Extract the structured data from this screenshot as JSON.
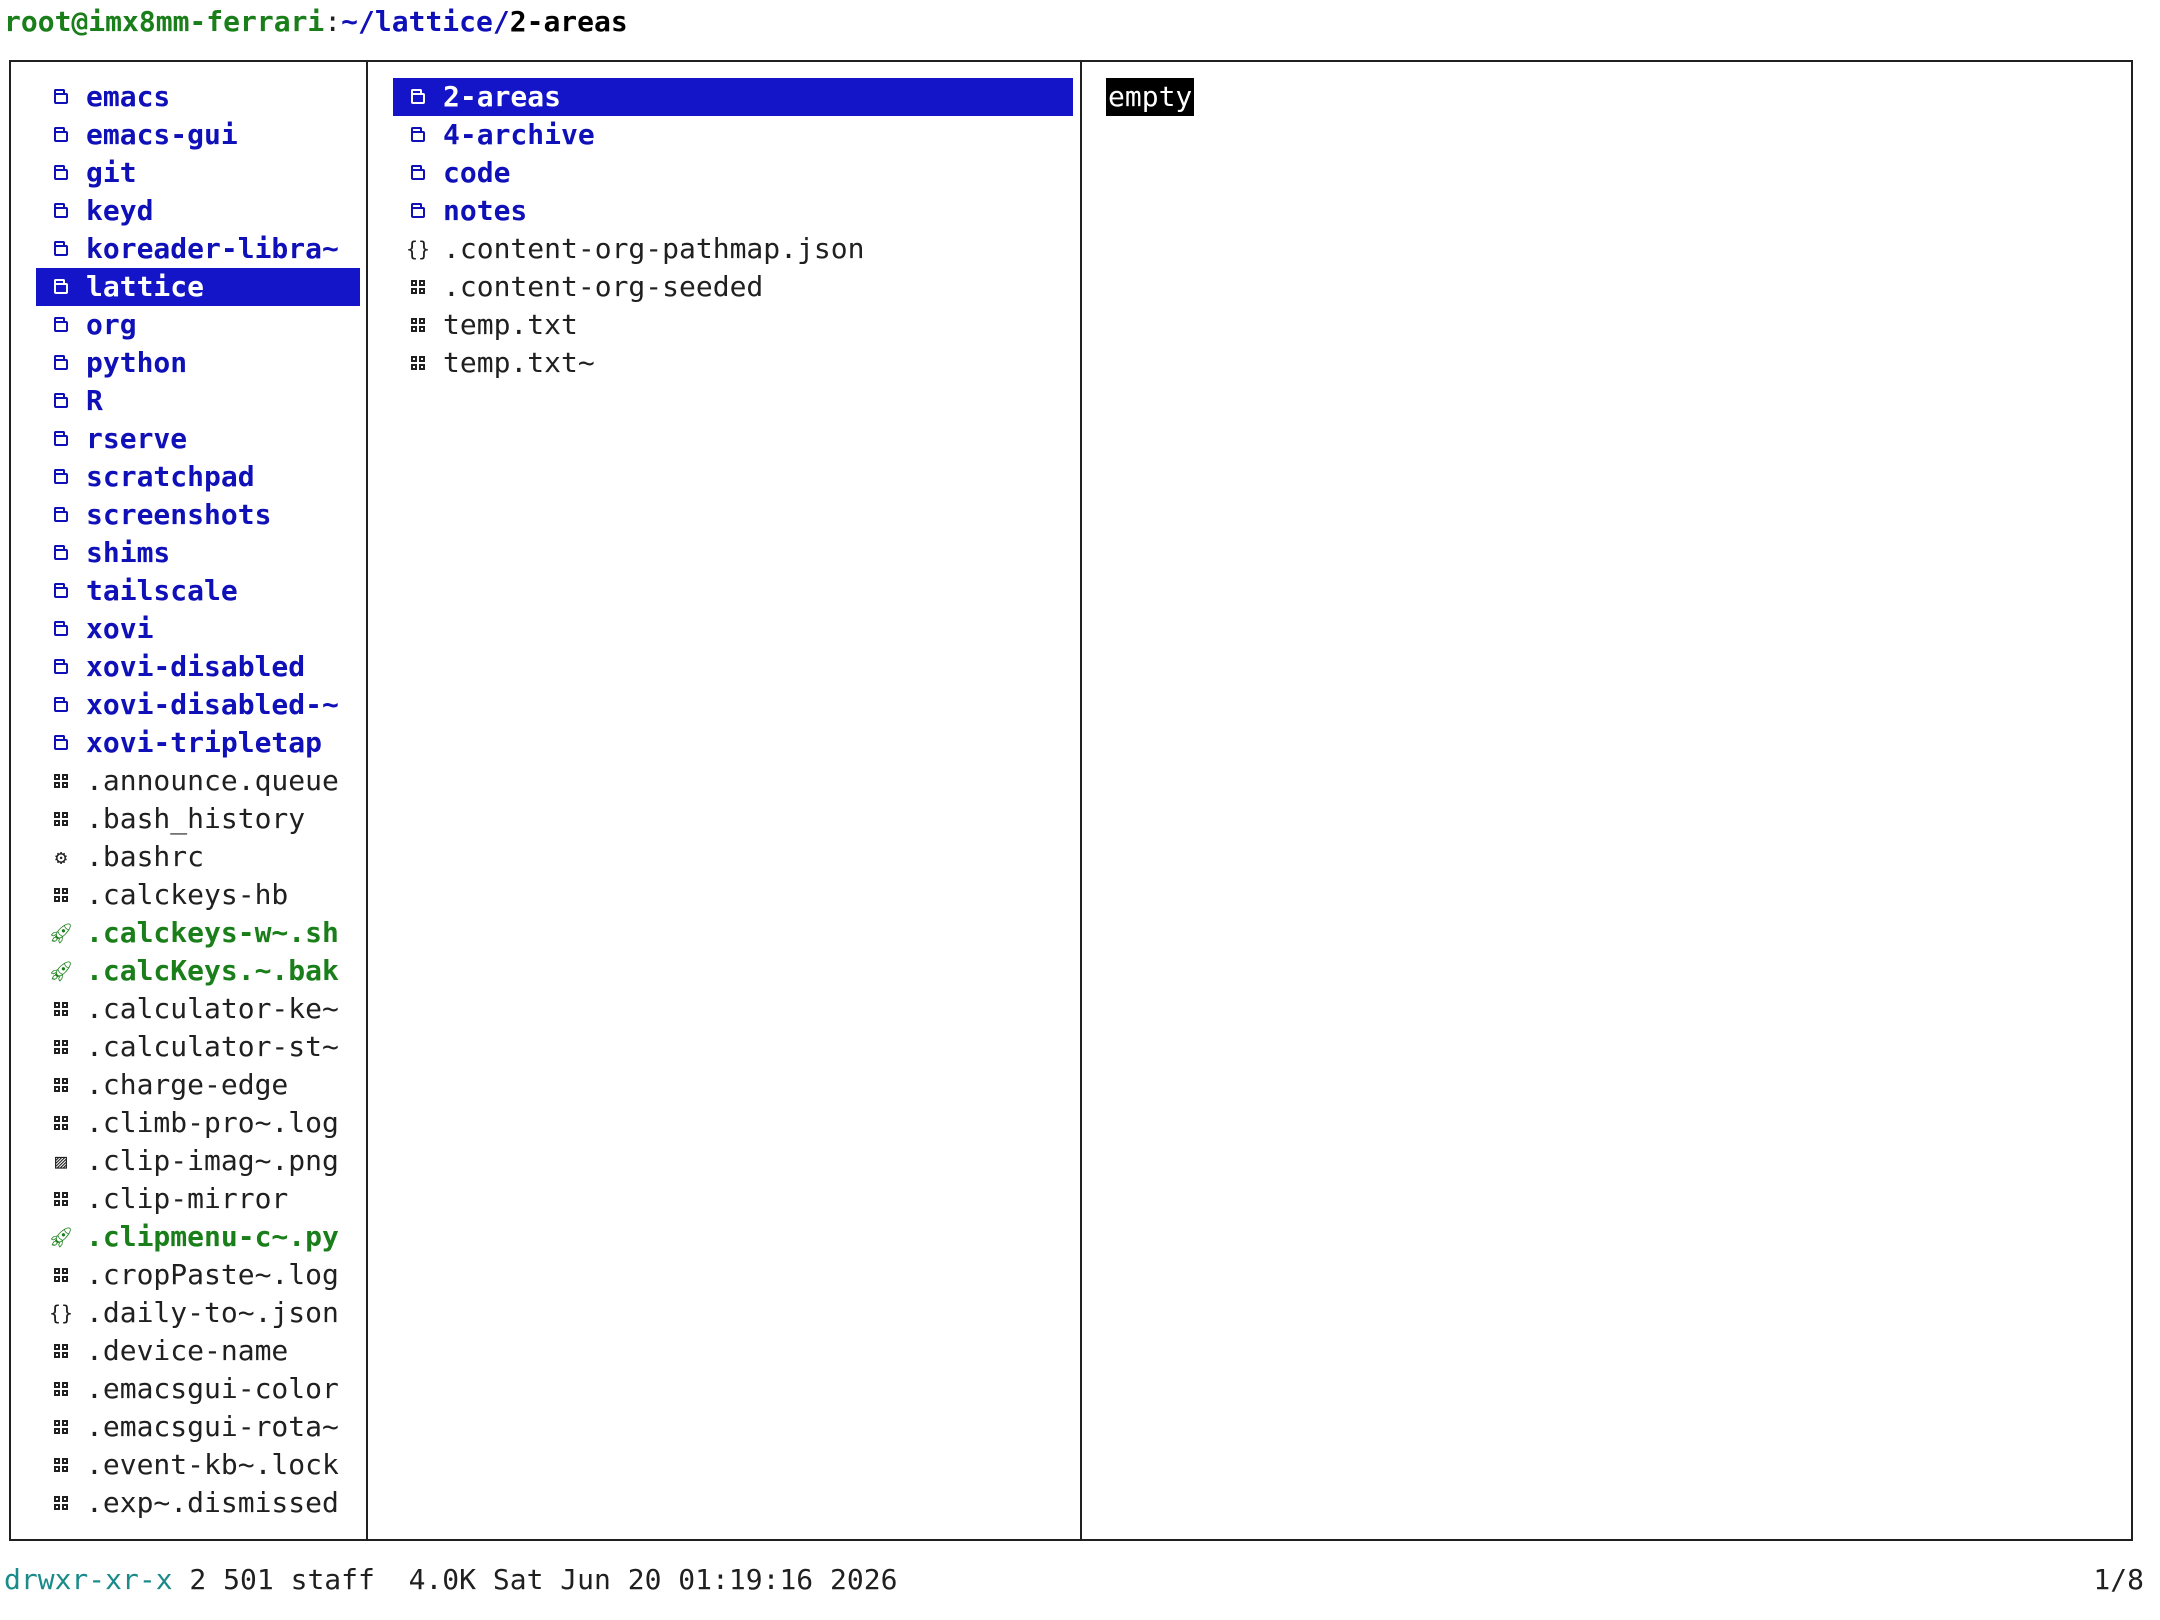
{
  "titlebar": {
    "user_host": "root@imx8mm-ferrari",
    "separator": ":",
    "path": "~/lattice/",
    "current": "2-areas"
  },
  "left_pane": [
    {
      "name": "emacs",
      "kind": "dir",
      "icon": "folder-icon"
    },
    {
      "name": "emacs-gui",
      "kind": "dir",
      "icon": "folder-icon"
    },
    {
      "name": "git",
      "kind": "dir",
      "icon": "folder-icon"
    },
    {
      "name": "keyd",
      "kind": "dir",
      "icon": "folder-icon"
    },
    {
      "name": "koreader-libra~",
      "kind": "dir",
      "icon": "folder-icon"
    },
    {
      "name": "lattice",
      "kind": "dir",
      "icon": "folder-icon",
      "selected": true
    },
    {
      "name": "org",
      "kind": "dir",
      "icon": "folder-icon"
    },
    {
      "name": "python",
      "kind": "dir",
      "icon": "folder-icon"
    },
    {
      "name": "R",
      "kind": "dir",
      "icon": "folder-icon"
    },
    {
      "name": "rserve",
      "kind": "dir",
      "icon": "folder-icon"
    },
    {
      "name": "scratchpad",
      "kind": "dir",
      "icon": "folder-icon"
    },
    {
      "name": "screenshots",
      "kind": "dir",
      "icon": "folder-icon"
    },
    {
      "name": "shims",
      "kind": "dir",
      "icon": "folder-icon"
    },
    {
      "name": "tailscale",
      "kind": "dir",
      "icon": "folder-icon"
    },
    {
      "name": "xovi",
      "kind": "dir",
      "icon": "folder-icon"
    },
    {
      "name": "xovi-disabled",
      "kind": "dir",
      "icon": "folder-icon"
    },
    {
      "name": "xovi-disabled-~",
      "kind": "dir",
      "icon": "folder-icon"
    },
    {
      "name": "xovi-tripletap",
      "kind": "dir",
      "icon": "folder-icon"
    },
    {
      "name": ".announce.queue",
      "kind": "file",
      "icon": "file-grid-icon"
    },
    {
      "name": ".bash_history",
      "kind": "file",
      "icon": "file-grid-icon"
    },
    {
      "name": ".bashrc",
      "kind": "file",
      "icon": "gear-icon"
    },
    {
      "name": ".calckeys-hb",
      "kind": "file",
      "icon": "file-grid-icon"
    },
    {
      "name": ".calckeys-w~.sh",
      "kind": "exe",
      "icon": "rocket-icon"
    },
    {
      "name": ".calcKeys.~.bak",
      "kind": "exe",
      "icon": "rocket-icon"
    },
    {
      "name": ".calculator-ke~",
      "kind": "file",
      "icon": "file-grid-icon"
    },
    {
      "name": ".calculator-st~",
      "kind": "file",
      "icon": "file-grid-icon"
    },
    {
      "name": ".charge-edge",
      "kind": "file",
      "icon": "file-grid-icon"
    },
    {
      "name": ".climb-pro~.log",
      "kind": "file",
      "icon": "file-grid-icon"
    },
    {
      "name": ".clip-imag~.png",
      "kind": "file",
      "icon": "image-icon"
    },
    {
      "name": ".clip-mirror",
      "kind": "file",
      "icon": "file-grid-icon"
    },
    {
      "name": ".clipmenu-c~.py",
      "kind": "exe",
      "icon": "rocket-icon"
    },
    {
      "name": ".cropPaste~.log",
      "kind": "file",
      "icon": "file-grid-icon"
    },
    {
      "name": ".daily-to~.json",
      "kind": "file",
      "icon": "json-braces-icon"
    },
    {
      "name": ".device-name",
      "kind": "file",
      "icon": "file-grid-icon"
    },
    {
      "name": ".emacsgui-color",
      "kind": "file",
      "icon": "file-grid-icon"
    },
    {
      "name": ".emacsgui-rota~",
      "kind": "file",
      "icon": "file-grid-icon"
    },
    {
      "name": ".event-kb~.lock",
      "kind": "file",
      "icon": "file-grid-icon"
    },
    {
      "name": ".exp~.dismissed",
      "kind": "file",
      "icon": "file-grid-icon"
    }
  ],
  "middle_pane": [
    {
      "name": "2-areas",
      "kind": "dir",
      "icon": "folder-icon",
      "selected": true
    },
    {
      "name": "4-archive",
      "kind": "dir",
      "icon": "folder-icon"
    },
    {
      "name": "code",
      "kind": "dir",
      "icon": "folder-icon"
    },
    {
      "name": "notes",
      "kind": "dir",
      "icon": "folder-icon"
    },
    {
      "name": ".content-org-pathmap.json",
      "kind": "file",
      "icon": "json-braces-icon"
    },
    {
      "name": ".content-org-seeded",
      "kind": "file",
      "icon": "file-grid-icon"
    },
    {
      "name": "temp.txt",
      "kind": "file",
      "icon": "file-grid-icon"
    },
    {
      "name": "temp.txt~",
      "kind": "file",
      "icon": "file-grid-icon"
    }
  ],
  "preview": {
    "text": "empty"
  },
  "statusbar": {
    "permissions": "drwxr-xr-x",
    "info": " 2 501 staff  4.0K Sat Jun 20 01:19:16 2026",
    "position": "1/8"
  },
  "colors": {
    "directory": "#1010b8",
    "executable": "#1a7f1a",
    "selection": "#1414c8",
    "permissions": "#1a8a8a"
  }
}
